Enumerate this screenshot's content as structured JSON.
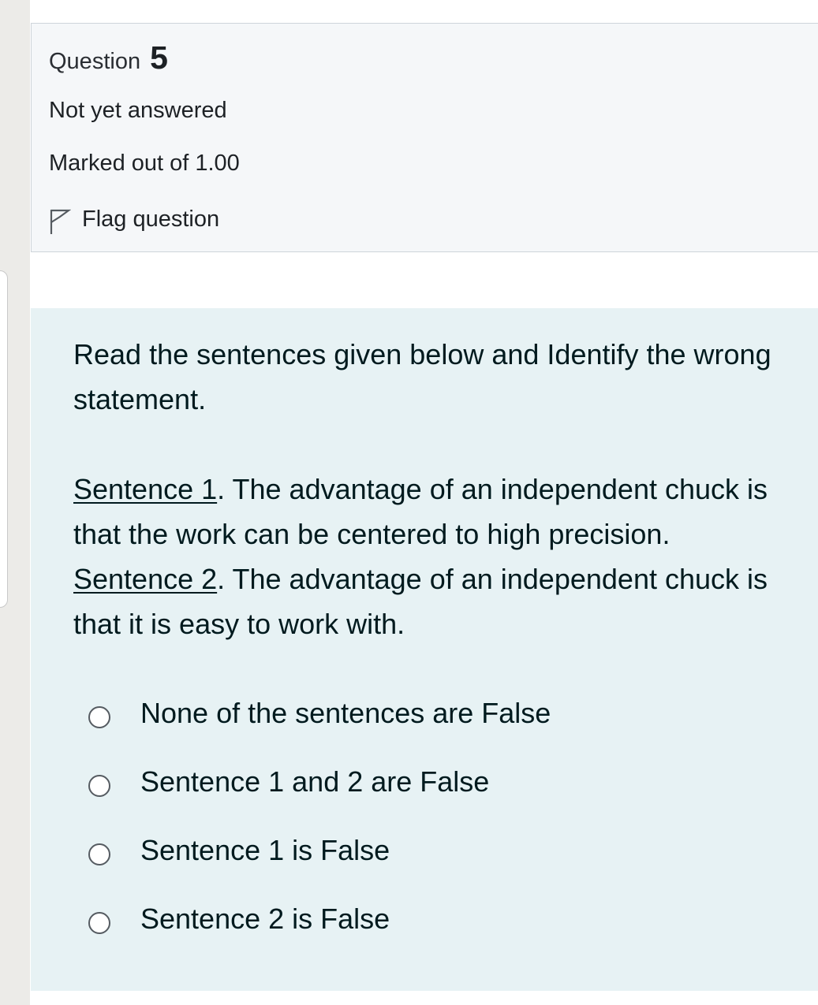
{
  "question_info": {
    "label": "Question",
    "number": "5",
    "state": "Not yet answered",
    "grade": "Marked out of 1.00",
    "flag_label": "Flag question"
  },
  "question_text": {
    "intro": "Read the sentences given below and Identify the wrong statement.",
    "sentences": [
      {
        "label": "Sentence 1",
        "text": ". The advantage of an independent chuck is that the work can be centered to high precision."
      },
      {
        "label": "Sentence 2",
        "text": ". The advantage of an independent chuck is that it is easy to work with."
      }
    ]
  },
  "answers": [
    {
      "label": "None of the sentences are False",
      "selected": false
    },
    {
      "label": "Sentence 1 and 2 are False",
      "selected": false
    },
    {
      "label": "Sentence 1 is False",
      "selected": false
    },
    {
      "label": "Sentence 2 is False",
      "selected": false
    }
  ],
  "icons": {
    "flag": "flag-outline-icon",
    "radio": "radio-unchecked-icon"
  },
  "colors": {
    "info_background": "#f5f7f9",
    "content_background": "#e7f2f4",
    "text": "#1d2125"
  }
}
